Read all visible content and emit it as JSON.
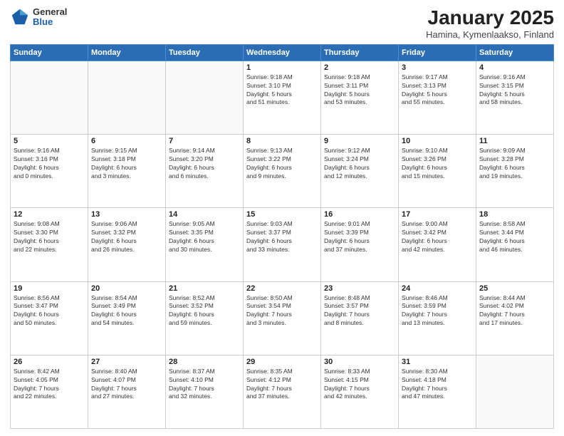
{
  "header": {
    "logo_general": "General",
    "logo_blue": "Blue",
    "month": "January 2025",
    "location": "Hamina, Kymenlaakso, Finland"
  },
  "weekdays": [
    "Sunday",
    "Monday",
    "Tuesday",
    "Wednesday",
    "Thursday",
    "Friday",
    "Saturday"
  ],
  "weeks": [
    [
      {
        "day": "",
        "info": ""
      },
      {
        "day": "",
        "info": ""
      },
      {
        "day": "",
        "info": ""
      },
      {
        "day": "1",
        "info": "Sunrise: 9:18 AM\nSunset: 3:10 PM\nDaylight: 5 hours\nand 51 minutes."
      },
      {
        "day": "2",
        "info": "Sunrise: 9:18 AM\nSunset: 3:11 PM\nDaylight: 5 hours\nand 53 minutes."
      },
      {
        "day": "3",
        "info": "Sunrise: 9:17 AM\nSunset: 3:13 PM\nDaylight: 5 hours\nand 55 minutes."
      },
      {
        "day": "4",
        "info": "Sunrise: 9:16 AM\nSunset: 3:15 PM\nDaylight: 5 hours\nand 58 minutes."
      }
    ],
    [
      {
        "day": "5",
        "info": "Sunrise: 9:16 AM\nSunset: 3:16 PM\nDaylight: 6 hours\nand 0 minutes."
      },
      {
        "day": "6",
        "info": "Sunrise: 9:15 AM\nSunset: 3:18 PM\nDaylight: 6 hours\nand 3 minutes."
      },
      {
        "day": "7",
        "info": "Sunrise: 9:14 AM\nSunset: 3:20 PM\nDaylight: 6 hours\nand 6 minutes."
      },
      {
        "day": "8",
        "info": "Sunrise: 9:13 AM\nSunset: 3:22 PM\nDaylight: 6 hours\nand 9 minutes."
      },
      {
        "day": "9",
        "info": "Sunrise: 9:12 AM\nSunset: 3:24 PM\nDaylight: 6 hours\nand 12 minutes."
      },
      {
        "day": "10",
        "info": "Sunrise: 9:10 AM\nSunset: 3:26 PM\nDaylight: 6 hours\nand 15 minutes."
      },
      {
        "day": "11",
        "info": "Sunrise: 9:09 AM\nSunset: 3:28 PM\nDaylight: 6 hours\nand 19 minutes."
      }
    ],
    [
      {
        "day": "12",
        "info": "Sunrise: 9:08 AM\nSunset: 3:30 PM\nDaylight: 6 hours\nand 22 minutes."
      },
      {
        "day": "13",
        "info": "Sunrise: 9:06 AM\nSunset: 3:32 PM\nDaylight: 6 hours\nand 26 minutes."
      },
      {
        "day": "14",
        "info": "Sunrise: 9:05 AM\nSunset: 3:35 PM\nDaylight: 6 hours\nand 30 minutes."
      },
      {
        "day": "15",
        "info": "Sunrise: 9:03 AM\nSunset: 3:37 PM\nDaylight: 6 hours\nand 33 minutes."
      },
      {
        "day": "16",
        "info": "Sunrise: 9:01 AM\nSunset: 3:39 PM\nDaylight: 6 hours\nand 37 minutes."
      },
      {
        "day": "17",
        "info": "Sunrise: 9:00 AM\nSunset: 3:42 PM\nDaylight: 6 hours\nand 42 minutes."
      },
      {
        "day": "18",
        "info": "Sunrise: 8:58 AM\nSunset: 3:44 PM\nDaylight: 6 hours\nand 46 minutes."
      }
    ],
    [
      {
        "day": "19",
        "info": "Sunrise: 8:56 AM\nSunset: 3:47 PM\nDaylight: 6 hours\nand 50 minutes."
      },
      {
        "day": "20",
        "info": "Sunrise: 8:54 AM\nSunset: 3:49 PM\nDaylight: 6 hours\nand 54 minutes."
      },
      {
        "day": "21",
        "info": "Sunrise: 8:52 AM\nSunset: 3:52 PM\nDaylight: 6 hours\nand 59 minutes."
      },
      {
        "day": "22",
        "info": "Sunrise: 8:50 AM\nSunset: 3:54 PM\nDaylight: 7 hours\nand 3 minutes."
      },
      {
        "day": "23",
        "info": "Sunrise: 8:48 AM\nSunset: 3:57 PM\nDaylight: 7 hours\nand 8 minutes."
      },
      {
        "day": "24",
        "info": "Sunrise: 8:46 AM\nSunset: 3:59 PM\nDaylight: 7 hours\nand 13 minutes."
      },
      {
        "day": "25",
        "info": "Sunrise: 8:44 AM\nSunset: 4:02 PM\nDaylight: 7 hours\nand 17 minutes."
      }
    ],
    [
      {
        "day": "26",
        "info": "Sunrise: 8:42 AM\nSunset: 4:05 PM\nDaylight: 7 hours\nand 22 minutes."
      },
      {
        "day": "27",
        "info": "Sunrise: 8:40 AM\nSunset: 4:07 PM\nDaylight: 7 hours\nand 27 minutes."
      },
      {
        "day": "28",
        "info": "Sunrise: 8:37 AM\nSunset: 4:10 PM\nDaylight: 7 hours\nand 32 minutes."
      },
      {
        "day": "29",
        "info": "Sunrise: 8:35 AM\nSunset: 4:12 PM\nDaylight: 7 hours\nand 37 minutes."
      },
      {
        "day": "30",
        "info": "Sunrise: 8:33 AM\nSunset: 4:15 PM\nDaylight: 7 hours\nand 42 minutes."
      },
      {
        "day": "31",
        "info": "Sunrise: 8:30 AM\nSunset: 4:18 PM\nDaylight: 7 hours\nand 47 minutes."
      },
      {
        "day": "",
        "info": ""
      }
    ]
  ]
}
